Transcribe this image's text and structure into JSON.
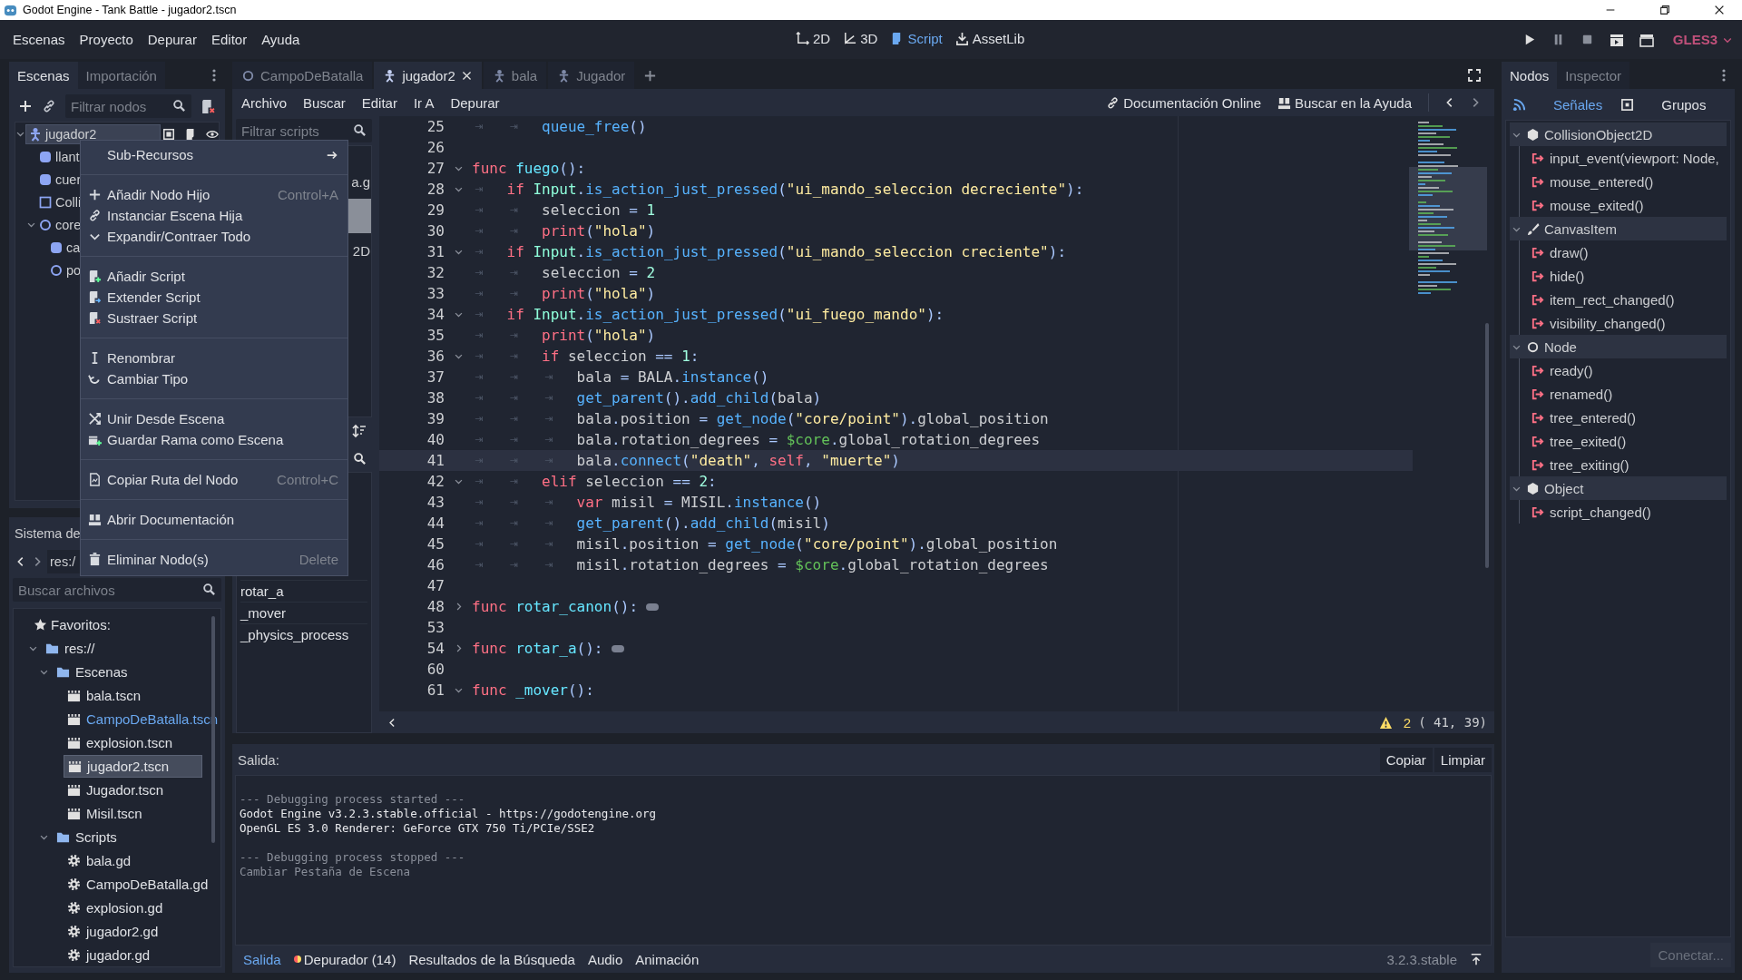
{
  "window": {
    "title": "Godot Engine - Tank Battle - jugador2.tscn"
  },
  "menu": [
    "Escenas",
    "Proyecto",
    "Depurar",
    "Editor",
    "Ayuda"
  ],
  "workspaces": [
    {
      "label": "2D",
      "kind": "canvas",
      "selected": false
    },
    {
      "label": "3D",
      "kind": "spatial",
      "selected": false
    },
    {
      "label": "Script",
      "kind": "script",
      "selected": true
    },
    {
      "label": "AssetLib",
      "kind": "library",
      "selected": false
    }
  ],
  "renderer": "GLES3",
  "scene_dock": {
    "tabs": [
      {
        "label": "Escenas",
        "selected": true
      },
      {
        "label": "Importación",
        "selected": false
      }
    ],
    "filter": {
      "placeholder": "Filtrar nodos"
    },
    "tree": [
      {
        "name": "jugador2",
        "kind": "player",
        "selected": true,
        "expanded": true,
        "children": [
          {
            "name": "llant",
            "kind": "sprite",
            "selected": false
          },
          {
            "name": "cuer",
            "kind": "sprite",
            "selected": false
          },
          {
            "name": "Colli",
            "kind": "collision",
            "selected": false
          },
          {
            "name": "core",
            "kind": "node2d",
            "selected": false,
            "expanded": true,
            "children": [
              {
                "name": "ca",
                "kind": "sprite",
                "selected": false
              },
              {
                "name": "po",
                "kind": "node2d",
                "selected": false
              }
            ]
          }
        ]
      }
    ]
  },
  "context_menu": [
    {
      "kind": "submenu",
      "label": "Sub-Recursos"
    },
    {
      "kind": "separator"
    },
    {
      "kind": "add",
      "label": "Añadir Nodo Hijo",
      "shortcut": "Control+A"
    },
    {
      "kind": "instance",
      "label": "Instanciar Escena Hija"
    },
    {
      "kind": "expand",
      "label": "Expandir/Contraer Todo"
    },
    {
      "kind": "separator"
    },
    {
      "kind": "add-script",
      "label": "Añadir Script"
    },
    {
      "kind": "extend-script",
      "label": "Extender Script"
    },
    {
      "kind": "remove-script",
      "label": "Sustraer Script"
    },
    {
      "kind": "separator"
    },
    {
      "kind": "rename",
      "label": "Renombrar"
    },
    {
      "kind": "change-type",
      "label": "Cambiar Tipo"
    },
    {
      "kind": "separator"
    },
    {
      "kind": "merge",
      "label": "Unir Desde Escena"
    },
    {
      "kind": "save-branch",
      "label": "Guardar Rama como Escena"
    },
    {
      "kind": "separator"
    },
    {
      "kind": "copy-path",
      "label": "Copiar Ruta del Nodo",
      "shortcut": "Control+C"
    },
    {
      "kind": "separator"
    },
    {
      "kind": "docs",
      "label": "Abrir Documentación"
    },
    {
      "kind": "separator"
    },
    {
      "kind": "delete",
      "label": "Eliminar Nodo(s)",
      "shortcut": "Delete"
    }
  ],
  "filesystem": {
    "title": "Sistema de",
    "path": "res:/",
    "search": {
      "placeholder": "Buscar archivos"
    },
    "favorites": "Favoritos:",
    "tree": [
      {
        "name": "res://",
        "kind": "folder",
        "expanded": true,
        "selected": false,
        "children": [
          {
            "name": "Escenas",
            "kind": "folder",
            "expanded": true,
            "selected": false,
            "children": [
              {
                "name": "bala.tscn",
                "kind": "scene",
                "main": false,
                "selected": false
              },
              {
                "name": "CampoDeBatalla.tscn",
                "kind": "scene",
                "main": true,
                "selected": false
              },
              {
                "name": "explosion.tscn",
                "kind": "scene",
                "main": false,
                "selected": false
              },
              {
                "name": "jugador2.tscn",
                "kind": "scene",
                "main": false,
                "selected": true
              },
              {
                "name": "Jugador.tscn",
                "kind": "scene",
                "main": false,
                "selected": false
              },
              {
                "name": "Misil.tscn",
                "kind": "scene",
                "main": false,
                "selected": false
              }
            ]
          },
          {
            "name": "Scripts",
            "kind": "folder",
            "expanded": true,
            "selected": false,
            "children": [
              {
                "name": "bala.gd",
                "kind": "script",
                "selected": false
              },
              {
                "name": "CampoDeBatalla.gd",
                "kind": "script",
                "selected": false
              },
              {
                "name": "explosion.gd",
                "kind": "script",
                "selected": false
              },
              {
                "name": "jugador2.gd",
                "kind": "script",
                "selected": false
              },
              {
                "name": "jugador.gd",
                "kind": "script",
                "selected": false
              }
            ]
          }
        ]
      }
    ]
  },
  "scene_tabs": [
    {
      "label": "CampoDeBatalla",
      "kind": "node2d",
      "selected": false
    },
    {
      "label": "jugador2",
      "kind": "player",
      "selected": true
    },
    {
      "label": "bala",
      "kind": "player",
      "selected": false
    },
    {
      "label": "Jugador",
      "kind": "player",
      "selected": false
    }
  ],
  "script_editor": {
    "menus": [
      "Archivo",
      "Buscar",
      "Editar",
      "Ir A",
      "Depurar"
    ],
    "help_links": [
      {
        "label": "Documentación Online",
        "kind": "online"
      },
      {
        "label": "Buscar en la Ayuda",
        "kind": "search"
      }
    ],
    "script_list": {
      "filter": {
        "placeholder": "Filtrar scripts"
      },
      "items": [
        {
          "text": "a.g",
          "selected": false
        },
        {
          "selected": true
        },
        {
          "text": "2D",
          "selected": false
        }
      ]
    },
    "methods": [
      "rotar_a",
      "_mover",
      "_physics_process"
    ],
    "code": [
      {
        "number": "25",
        "foldable": false,
        "current": false,
        "indent": [
          "⇥",
          "⇥"
        ],
        "tokens": [
          {
            "kind": "fn",
            "text": "queue_free"
          },
          {
            "kind": "sym",
            "text": "()"
          }
        ]
      },
      {
        "number": "26",
        "foldable": false,
        "current": false
      },
      {
        "number": "27",
        "foldable": true,
        "expanded": true,
        "current": false,
        "tokens": [
          {
            "kind": "kw",
            "text": "func"
          },
          {
            "kind": "def",
            "text": " fuego"
          },
          {
            "kind": "sym",
            "text": "():"
          }
        ]
      },
      {
        "number": "28",
        "foldable": true,
        "expanded": true,
        "current": false,
        "indent": [
          "⇥"
        ],
        "tokens": [
          {
            "kind": "kw",
            "text": "if"
          },
          {
            "kind": "type",
            "text": " Input"
          },
          {
            "kind": "sym",
            "text": "."
          },
          {
            "kind": "fn",
            "text": "is_action_just_pressed"
          },
          {
            "kind": "sym",
            "text": "("
          },
          {
            "kind": "str",
            "text": "\"ui_mando_seleccion decreciente\""
          },
          {
            "kind": "sym",
            "text": "):"
          }
        ]
      },
      {
        "number": "29",
        "foldable": false,
        "current": false,
        "indent": [
          "⇥",
          "⇥"
        ],
        "tokens": [
          {
            "kind": "txt",
            "text": "seleccion "
          },
          {
            "kind": "sym",
            "text": "="
          },
          {
            "kind": "num",
            "text": " 1"
          }
        ]
      },
      {
        "number": "30",
        "foldable": false,
        "current": false,
        "indent": [
          "⇥",
          "⇥"
        ],
        "tokens": [
          {
            "kind": "kw",
            "text": "print"
          },
          {
            "kind": "sym",
            "text": "("
          },
          {
            "kind": "str",
            "text": "\"hola\""
          },
          {
            "kind": "sym",
            "text": ")"
          }
        ]
      },
      {
        "number": "31",
        "foldable": true,
        "expanded": true,
        "current": false,
        "indent": [
          "⇥"
        ],
        "tokens": [
          {
            "kind": "kw",
            "text": "if"
          },
          {
            "kind": "type",
            "text": " Input"
          },
          {
            "kind": "sym",
            "text": "."
          },
          {
            "kind": "fn",
            "text": "is_action_just_pressed"
          },
          {
            "kind": "sym",
            "text": "("
          },
          {
            "kind": "str",
            "text": "\"ui_mando_seleccion creciente\""
          },
          {
            "kind": "sym",
            "text": "):"
          }
        ]
      },
      {
        "number": "32",
        "foldable": false,
        "current": false,
        "indent": [
          "⇥",
          "⇥"
        ],
        "tokens": [
          {
            "kind": "txt",
            "text": "seleccion "
          },
          {
            "kind": "sym",
            "text": "="
          },
          {
            "kind": "num",
            "text": " 2"
          }
        ]
      },
      {
        "number": "33",
        "foldable": false,
        "current": false,
        "indent": [
          "⇥",
          "⇥"
        ],
        "tokens": [
          {
            "kind": "kw",
            "text": "print"
          },
          {
            "kind": "sym",
            "text": "("
          },
          {
            "kind": "str",
            "text": "\"hola\""
          },
          {
            "kind": "sym",
            "text": ")"
          }
        ]
      },
      {
        "number": "34",
        "foldable": true,
        "expanded": true,
        "current": false,
        "indent": [
          "⇥"
        ],
        "tokens": [
          {
            "kind": "kw",
            "text": "if"
          },
          {
            "kind": "type",
            "text": " Input"
          },
          {
            "kind": "sym",
            "text": "."
          },
          {
            "kind": "fn",
            "text": "is_action_just_pressed"
          },
          {
            "kind": "sym",
            "text": "("
          },
          {
            "kind": "str",
            "text": "\"ui_fuego_mando\""
          },
          {
            "kind": "sym",
            "text": "):"
          }
        ]
      },
      {
        "number": "35",
        "foldable": false,
        "current": false,
        "indent": [
          "⇥",
          "⇥"
        ],
        "tokens": [
          {
            "kind": "kw",
            "text": "print"
          },
          {
            "kind": "sym",
            "text": "("
          },
          {
            "kind": "str",
            "text": "\"hola\""
          },
          {
            "kind": "sym",
            "text": ")"
          }
        ]
      },
      {
        "number": "36",
        "foldable": true,
        "expanded": true,
        "current": false,
        "indent": [
          "⇥",
          "⇥"
        ],
        "tokens": [
          {
            "kind": "kw",
            "text": "if"
          },
          {
            "kind": "txt",
            "text": " seleccion "
          },
          {
            "kind": "sym",
            "text": "=="
          },
          {
            "kind": "num",
            "text": " 1"
          },
          {
            "kind": "sym",
            "text": ":"
          }
        ]
      },
      {
        "number": "37",
        "foldable": false,
        "current": false,
        "indent": [
          "⇥",
          "⇥",
          "⇥"
        ],
        "tokens": [
          {
            "kind": "txt",
            "text": "bala "
          },
          {
            "kind": "sym",
            "text": "="
          },
          {
            "kind": "txt",
            "text": " BALA"
          },
          {
            "kind": "sym",
            "text": "."
          },
          {
            "kind": "fn",
            "text": "instance"
          },
          {
            "kind": "sym",
            "text": "()"
          }
        ]
      },
      {
        "number": "38",
        "foldable": false,
        "current": false,
        "indent": [
          "⇥",
          "⇥",
          "⇥"
        ],
        "tokens": [
          {
            "kind": "fn",
            "text": "get_parent"
          },
          {
            "kind": "sym",
            "text": "()."
          },
          {
            "kind": "fn",
            "text": "add_child"
          },
          {
            "kind": "sym",
            "text": "("
          },
          {
            "kind": "txt",
            "text": "bala"
          },
          {
            "kind": "sym",
            "text": ")"
          }
        ]
      },
      {
        "number": "39",
        "foldable": false,
        "current": false,
        "indent": [
          "⇥",
          "⇥",
          "⇥"
        ],
        "tokens": [
          {
            "kind": "txt",
            "text": "bala"
          },
          {
            "kind": "sym",
            "text": "."
          },
          {
            "kind": "txt",
            "text": "position "
          },
          {
            "kind": "sym",
            "text": "="
          },
          {
            "kind": "fn",
            "text": " get_node"
          },
          {
            "kind": "sym",
            "text": "("
          },
          {
            "kind": "str",
            "text": "\"core/point\""
          },
          {
            "kind": "sym",
            "text": ")."
          },
          {
            "kind": "txt",
            "text": "global_position"
          }
        ]
      },
      {
        "number": "40",
        "foldable": false,
        "current": false,
        "indent": [
          "⇥",
          "⇥",
          "⇥"
        ],
        "tokens": [
          {
            "kind": "txt",
            "text": "bala"
          },
          {
            "kind": "sym",
            "text": "."
          },
          {
            "kind": "txt",
            "text": "rotation_degrees "
          },
          {
            "kind": "sym",
            "text": "="
          },
          {
            "kind": "node",
            "text": " $core"
          },
          {
            "kind": "sym",
            "text": "."
          },
          {
            "kind": "txt",
            "text": "global_rotation_degrees"
          }
        ]
      },
      {
        "number": "41",
        "foldable": false,
        "current": true,
        "indent": [
          "⇥",
          "⇥",
          "⇥"
        ],
        "tokens": [
          {
            "kind": "txt",
            "text": "bala"
          },
          {
            "kind": "sym",
            "text": "."
          },
          {
            "kind": "fn",
            "text": "connect"
          },
          {
            "kind": "sym",
            "text": "("
          },
          {
            "kind": "str",
            "text": "\"death\""
          },
          {
            "kind": "sym",
            "text": ", "
          },
          {
            "kind": "kw",
            "text": "self"
          },
          {
            "kind": "sym",
            "text": ", "
          },
          {
            "kind": "str",
            "text": "\"muerte\""
          },
          {
            "kind": "sym",
            "text": ")"
          }
        ]
      },
      {
        "number": "42",
        "foldable": true,
        "expanded": true,
        "current": false,
        "indent": [
          "⇥",
          "⇥"
        ],
        "tokens": [
          {
            "kind": "kw",
            "text": "elif"
          },
          {
            "kind": "txt",
            "text": " seleccion "
          },
          {
            "kind": "sym",
            "text": "=="
          },
          {
            "kind": "num",
            "text": " 2"
          },
          {
            "kind": "sym",
            "text": ":"
          }
        ]
      },
      {
        "number": "43",
        "foldable": false,
        "current": false,
        "indent": [
          "⇥",
          "⇥",
          "⇥"
        ],
        "tokens": [
          {
            "kind": "kw",
            "text": "var"
          },
          {
            "kind": "txt",
            "text": " misil "
          },
          {
            "kind": "sym",
            "text": "="
          },
          {
            "kind": "txt",
            "text": " MISIL"
          },
          {
            "kind": "sym",
            "text": "."
          },
          {
            "kind": "fn",
            "text": "instance"
          },
          {
            "kind": "sym",
            "text": "()"
          }
        ]
      },
      {
        "number": "44",
        "foldable": false,
        "current": false,
        "indent": [
          "⇥",
          "⇥",
          "⇥"
        ],
        "tokens": [
          {
            "kind": "fn",
            "text": "get_parent"
          },
          {
            "kind": "sym",
            "text": "()."
          },
          {
            "kind": "fn",
            "text": "add_child"
          },
          {
            "kind": "sym",
            "text": "("
          },
          {
            "kind": "txt",
            "text": "misil"
          },
          {
            "kind": "sym",
            "text": ")"
          }
        ]
      },
      {
        "number": "45",
        "foldable": false,
        "current": false,
        "indent": [
          "⇥",
          "⇥",
          "⇥"
        ],
        "tokens": [
          {
            "kind": "txt",
            "text": "misil"
          },
          {
            "kind": "sym",
            "text": "."
          },
          {
            "kind": "txt",
            "text": "position "
          },
          {
            "kind": "sym",
            "text": "="
          },
          {
            "kind": "fn",
            "text": " get_node"
          },
          {
            "kind": "sym",
            "text": "("
          },
          {
            "kind": "str",
            "text": "\"core/point\""
          },
          {
            "kind": "sym",
            "text": ")."
          },
          {
            "kind": "txt",
            "text": "global_position"
          }
        ]
      },
      {
        "number": "46",
        "foldable": false,
        "current": false,
        "indent": [
          "⇥",
          "⇥",
          "⇥"
        ],
        "tokens": [
          {
            "kind": "txt",
            "text": "misil"
          },
          {
            "kind": "sym",
            "text": "."
          },
          {
            "kind": "txt",
            "text": "rotation_degrees "
          },
          {
            "kind": "sym",
            "text": "="
          },
          {
            "kind": "node",
            "text": " $core"
          },
          {
            "kind": "sym",
            "text": "."
          },
          {
            "kind": "txt",
            "text": "global_rotation_degrees"
          }
        ]
      },
      {
        "number": "47",
        "foldable": false,
        "current": false
      },
      {
        "number": "48",
        "foldable": true,
        "expanded": false,
        "current": false,
        "tokens": [
          {
            "kind": "kw",
            "text": "func"
          },
          {
            "kind": "def",
            "text": " rotar_canon"
          },
          {
            "kind": "sym",
            "text": "():"
          }
        ]
      },
      {
        "number": "53",
        "foldable": false,
        "current": false
      },
      {
        "number": "54",
        "foldable": true,
        "expanded": false,
        "current": false,
        "tokens": [
          {
            "kind": "kw",
            "text": "func"
          },
          {
            "kind": "def",
            "text": " rotar_a"
          },
          {
            "kind": "sym",
            "text": "():"
          }
        ]
      },
      {
        "number": "60",
        "foldable": false,
        "current": false
      },
      {
        "number": "61",
        "foldable": true,
        "expanded": true,
        "current": false,
        "tokens": [
          {
            "kind": "kw",
            "text": "func"
          },
          {
            "kind": "def",
            "text": " _mover"
          },
          {
            "kind": "sym",
            "text": "():"
          }
        ]
      }
    ],
    "status": {
      "warnings": "2",
      "position": "( 41, 39)"
    }
  },
  "output": {
    "title": "Salida:",
    "buttons": [
      "Copiar",
      "Limpiar"
    ],
    "lines": [
      {
        "kind": "header",
        "text": "--- Debugging process started ---"
      },
      {
        "kind": "info",
        "text": "Godot Engine v3.2.3.stable.official - https://godotengine.org"
      },
      {
        "kind": "info",
        "text": "OpenGL ES 3.0 Renderer: GeForce GTX 750 Ti/PCIe/SSE2"
      },
      {
        "kind": "header",
        "text": "--- Debugging process stopped ---"
      },
      {
        "kind": "note",
        "text": "Cambiar Pestaña de Escena"
      }
    ]
  },
  "bottom_tabs": [
    {
      "label": "Salida",
      "selected": true,
      "alert": false
    },
    {
      "label": "Depurador (14)",
      "selected": false,
      "alert": true
    },
    {
      "label": "Resultados de la Búsqueda",
      "selected": false,
      "alert": false
    },
    {
      "label": "Audio",
      "selected": false,
      "alert": false
    },
    {
      "label": "Animación",
      "selected": false,
      "alert": false
    }
  ],
  "version": "3.2.3.stable",
  "node_dock": {
    "tabs": [
      {
        "label": "Nodos",
        "selected": true
      },
      {
        "label": "Inspector",
        "selected": false
      }
    ],
    "modes": [
      {
        "label": "Señales",
        "kind": "signals",
        "selected": true
      },
      {
        "label": "Grupos",
        "kind": "groups",
        "selected": false
      }
    ],
    "signals": [
      {
        "class": "CollisionObject2D",
        "kind": "object",
        "expanded": true,
        "children": [
          "input_event(viewport: Node,",
          "mouse_entered()",
          "mouse_exited()"
        ]
      },
      {
        "class": "CanvasItem",
        "kind": "canvas",
        "expanded": true,
        "children": [
          "draw()",
          "hide()",
          "item_rect_changed()",
          "visibility_changed()"
        ]
      },
      {
        "class": "Node",
        "kind": "node",
        "expanded": true,
        "children": [
          "ready()",
          "renamed()",
          "tree_entered()",
          "tree_exited()",
          "tree_exiting()"
        ]
      },
      {
        "class": "Object",
        "kind": "object",
        "expanded": true,
        "children": [
          "script_changed()"
        ]
      }
    ],
    "connect_button": {
      "label": "Conectar...",
      "disabled": true
    }
  }
}
